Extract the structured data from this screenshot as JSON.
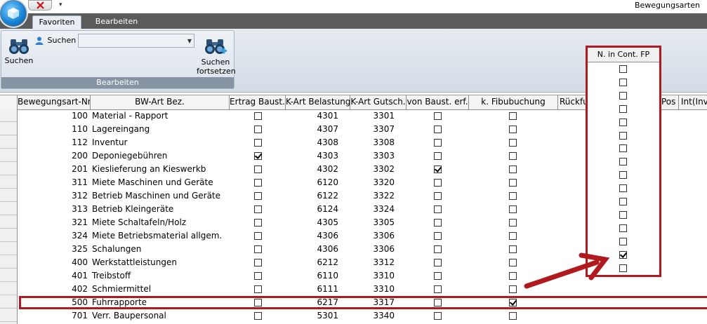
{
  "window": {
    "title": "Bewegungsarten"
  },
  "ribbon": {
    "tabs": [
      {
        "label": "Favoriten",
        "active": true
      },
      {
        "label": "Bearbeiten",
        "active": false
      }
    ],
    "group": {
      "caption": "Bearbeiten",
      "search_button_label": "Suchen",
      "search_field_label": "Suchen",
      "search_field_value": "",
      "continue_button_label": "Suchen\nfortsetzen"
    }
  },
  "grid": {
    "columns": [
      "Bewegungsart-Nr",
      "BW-Art Bez.",
      "Ertrag Baust.",
      "K-Art Belastung",
      "K-Art Gutsch.",
      "von Baust. erf.",
      "k. Fibubuchung",
      "Rückfu",
      "Pos",
      "Int(Inv"
    ],
    "rows": [
      {
        "nr": "100",
        "bez": "Material - Rapport",
        "ertrag": false,
        "belastung": "4301",
        "gutsch": "3301",
        "von_baust": false,
        "fibu": false
      },
      {
        "nr": "110",
        "bez": "Lagereingang",
        "ertrag": false,
        "belastung": "4307",
        "gutsch": "3307",
        "von_baust": false,
        "fibu": false
      },
      {
        "nr": "112",
        "bez": "Inventur",
        "ertrag": false,
        "belastung": "4308",
        "gutsch": "3308",
        "von_baust": false,
        "fibu": false
      },
      {
        "nr": "200",
        "bez": "Deponiegebühren",
        "ertrag": true,
        "belastung": "4303",
        "gutsch": "3303",
        "von_baust": false,
        "fibu": false
      },
      {
        "nr": "201",
        "bez": "Kieslieferung an Kieswerkb",
        "ertrag": false,
        "belastung": "4302",
        "gutsch": "3302",
        "von_baust": true,
        "fibu": false
      },
      {
        "nr": "311",
        "bez": "Miete Maschinen und Geräte",
        "ertrag": false,
        "belastung": "6120",
        "gutsch": "3320",
        "von_baust": false,
        "fibu": false
      },
      {
        "nr": "312",
        "bez": "Betrieb Maschinen und Geräte",
        "ertrag": false,
        "belastung": "6122",
        "gutsch": "3322",
        "von_baust": false,
        "fibu": false
      },
      {
        "nr": "313",
        "bez": "Betrieb Kleingeräte",
        "ertrag": false,
        "belastung": "6124",
        "gutsch": "3324",
        "von_baust": false,
        "fibu": false
      },
      {
        "nr": "321",
        "bez": "Miete Schaltafeln/Holz",
        "ertrag": false,
        "belastung": "4305",
        "gutsch": "3305",
        "von_baust": false,
        "fibu": false
      },
      {
        "nr": "324",
        "bez": "Miete Betriebsmaterial allgem.",
        "ertrag": false,
        "belastung": "4306",
        "gutsch": "3306",
        "von_baust": false,
        "fibu": false
      },
      {
        "nr": "325",
        "bez": "Schalungen",
        "ertrag": false,
        "belastung": "4306",
        "gutsch": "3306",
        "von_baust": false,
        "fibu": false
      },
      {
        "nr": "400",
        "bez": "Werkstattleistungen",
        "ertrag": false,
        "belastung": "6212",
        "gutsch": "3312",
        "von_baust": false,
        "fibu": false
      },
      {
        "nr": "401",
        "bez": "Treibstoff",
        "ertrag": false,
        "belastung": "6110",
        "gutsch": "3310",
        "von_baust": false,
        "fibu": false
      },
      {
        "nr": "402",
        "bez": "Schmiermittel",
        "ertrag": false,
        "belastung": "6111",
        "gutsch": "3310",
        "von_baust": false,
        "fibu": false
      },
      {
        "nr": "500",
        "bez": "Fuhrrapporte",
        "ertrag": false,
        "belastung": "6217",
        "gutsch": "3317",
        "von_baust": false,
        "fibu": true
      },
      {
        "nr": "701",
        "bez": "Verr. Baupersonal",
        "ertrag": false,
        "belastung": "5301",
        "gutsch": "3340",
        "von_baust": false,
        "fibu": false
      }
    ]
  },
  "annotation": {
    "column_title": "N. in Cont. FP",
    "checkboxes": [
      false,
      false,
      false,
      false,
      false,
      false,
      false,
      false,
      false,
      false,
      false,
      false,
      false,
      false,
      true,
      false
    ],
    "color": "#b0191e"
  }
}
